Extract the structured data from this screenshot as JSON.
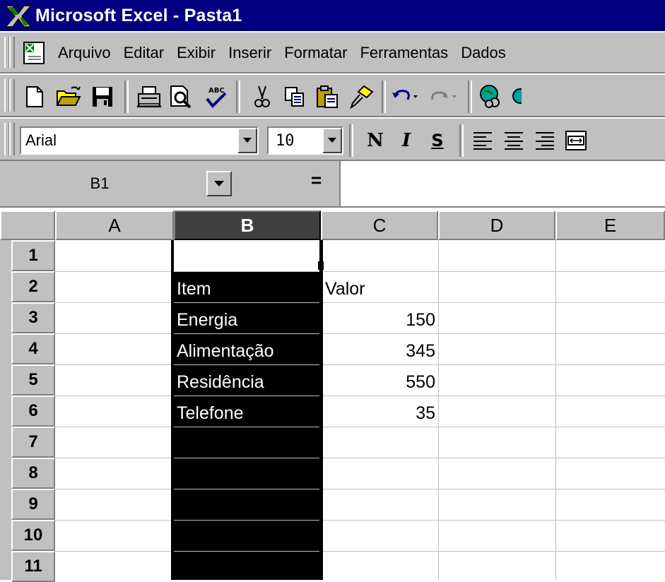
{
  "window": {
    "title": "Microsoft Excel - Pasta1"
  },
  "menu": {
    "items": [
      {
        "label": "Arquivo"
      },
      {
        "label": "Editar"
      },
      {
        "label": "Exibir"
      },
      {
        "label": "Inserir"
      },
      {
        "label": "Formatar"
      },
      {
        "label": "Ferramentas"
      },
      {
        "label": "Dados"
      }
    ]
  },
  "format": {
    "font": "Arial",
    "size": "10",
    "bold_label": "N",
    "italic_label": "I",
    "underline_label": "S"
  },
  "formula_bar": {
    "name_box": "B1",
    "equals": "=",
    "content": ""
  },
  "sheet": {
    "columns": [
      "A",
      "B",
      "C",
      "D",
      "E"
    ],
    "selected_column": "B",
    "active_cell": "B1",
    "rows": [
      "1",
      "2",
      "3",
      "4",
      "5",
      "6",
      "7",
      "8",
      "9",
      "10",
      "11"
    ],
    "cells": {
      "B2": "Item",
      "C2": "Valor",
      "B3": "Energia",
      "C3": "150",
      "B4": "Alimentação",
      "C4": "345",
      "B5": "Residência",
      "C5": "550",
      "B6": "Telefone",
      "C6": "35"
    }
  },
  "colors": {
    "title_bar": "#000080",
    "chrome": "#c0c0c0",
    "selection": "#000000"
  }
}
